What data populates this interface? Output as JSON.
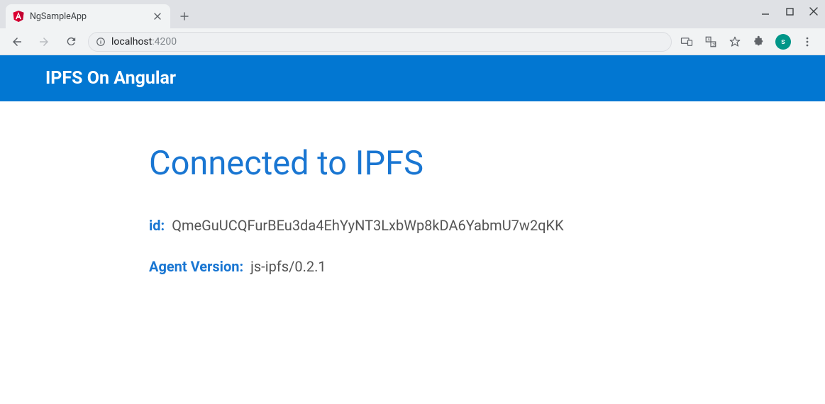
{
  "browser": {
    "tab_title": "NgSampleApp",
    "url_host": "localhost",
    "url_port": ":4200",
    "avatar_initial": "s"
  },
  "header": {
    "title": "IPFS On Angular"
  },
  "main": {
    "heading": "Connected to IPFS",
    "id_label": "id:",
    "id_value": "QmeGuUCQFurBEu3da4EhYyNT3LxbWp8kDA6YabmU7w2qKK",
    "agent_label": "Agent Version:",
    "agent_value": "js-ipfs/0.2.1"
  }
}
